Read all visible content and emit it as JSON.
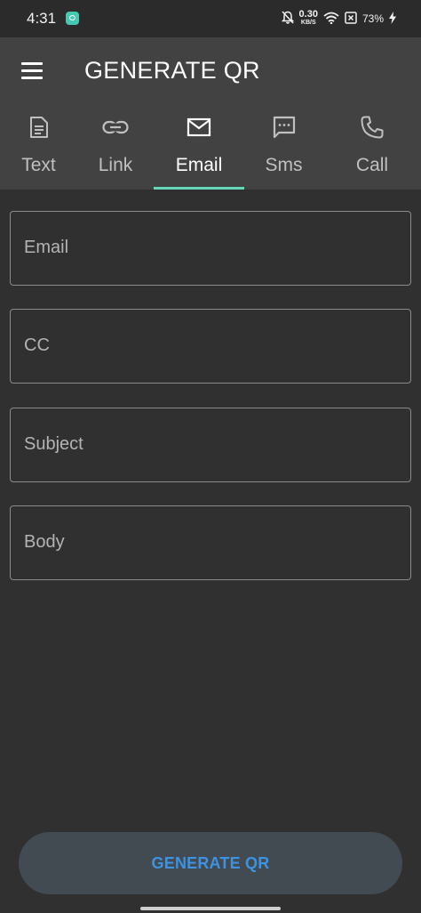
{
  "status_bar": {
    "time": "4:31",
    "net_speed_value": "0.30",
    "net_speed_unit": "KB/S",
    "battery_percent": "73%"
  },
  "app_bar": {
    "title": "GENERATE QR"
  },
  "tabs": [
    {
      "label": "Text",
      "icon": "document-icon",
      "active": false
    },
    {
      "label": "Link",
      "icon": "link-icon",
      "active": false
    },
    {
      "label": "Email",
      "icon": "mail-icon",
      "active": true
    },
    {
      "label": "Sms",
      "icon": "message-icon",
      "active": false
    },
    {
      "label": "Call",
      "icon": "phone-icon",
      "active": false
    }
  ],
  "form": {
    "email_placeholder": "Email",
    "cc_placeholder": "CC",
    "subject_placeholder": "Subject",
    "body_placeholder": "Body"
  },
  "generate_button": {
    "label": "GENERATE QR"
  },
  "colors": {
    "background": "#303030",
    "app_bar": "#424242",
    "tab_indicator": "#64d8b8",
    "button_text": "#3d93e0",
    "button_bg": "#424a52"
  }
}
